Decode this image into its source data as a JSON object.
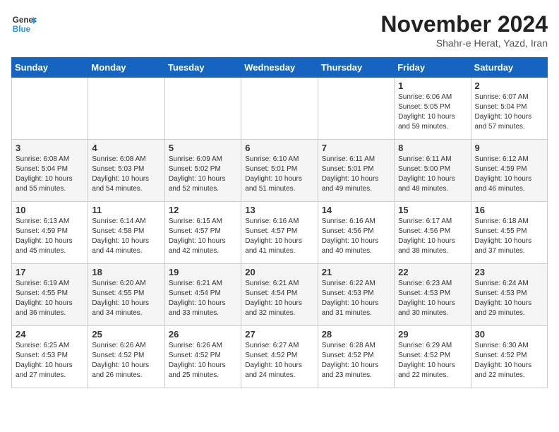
{
  "logo": {
    "general": "General",
    "blue": "Blue"
  },
  "title": "November 2024",
  "location": "Shahr-e Herat, Yazd, Iran",
  "weekdays": [
    "Sunday",
    "Monday",
    "Tuesday",
    "Wednesday",
    "Thursday",
    "Friday",
    "Saturday"
  ],
  "weeks": [
    [
      {
        "day": "",
        "info": ""
      },
      {
        "day": "",
        "info": ""
      },
      {
        "day": "",
        "info": ""
      },
      {
        "day": "",
        "info": ""
      },
      {
        "day": "",
        "info": ""
      },
      {
        "day": "1",
        "info": "Sunrise: 6:06 AM\nSunset: 5:05 PM\nDaylight: 10 hours and 59 minutes."
      },
      {
        "day": "2",
        "info": "Sunrise: 6:07 AM\nSunset: 5:04 PM\nDaylight: 10 hours and 57 minutes."
      }
    ],
    [
      {
        "day": "3",
        "info": "Sunrise: 6:08 AM\nSunset: 5:04 PM\nDaylight: 10 hours and 55 minutes."
      },
      {
        "day": "4",
        "info": "Sunrise: 6:08 AM\nSunset: 5:03 PM\nDaylight: 10 hours and 54 minutes."
      },
      {
        "day": "5",
        "info": "Sunrise: 6:09 AM\nSunset: 5:02 PM\nDaylight: 10 hours and 52 minutes."
      },
      {
        "day": "6",
        "info": "Sunrise: 6:10 AM\nSunset: 5:01 PM\nDaylight: 10 hours and 51 minutes."
      },
      {
        "day": "7",
        "info": "Sunrise: 6:11 AM\nSunset: 5:01 PM\nDaylight: 10 hours and 49 minutes."
      },
      {
        "day": "8",
        "info": "Sunrise: 6:11 AM\nSunset: 5:00 PM\nDaylight: 10 hours and 48 minutes."
      },
      {
        "day": "9",
        "info": "Sunrise: 6:12 AM\nSunset: 4:59 PM\nDaylight: 10 hours and 46 minutes."
      }
    ],
    [
      {
        "day": "10",
        "info": "Sunrise: 6:13 AM\nSunset: 4:59 PM\nDaylight: 10 hours and 45 minutes."
      },
      {
        "day": "11",
        "info": "Sunrise: 6:14 AM\nSunset: 4:58 PM\nDaylight: 10 hours and 44 minutes."
      },
      {
        "day": "12",
        "info": "Sunrise: 6:15 AM\nSunset: 4:57 PM\nDaylight: 10 hours and 42 minutes."
      },
      {
        "day": "13",
        "info": "Sunrise: 6:16 AM\nSunset: 4:57 PM\nDaylight: 10 hours and 41 minutes."
      },
      {
        "day": "14",
        "info": "Sunrise: 6:16 AM\nSunset: 4:56 PM\nDaylight: 10 hours and 40 minutes."
      },
      {
        "day": "15",
        "info": "Sunrise: 6:17 AM\nSunset: 4:56 PM\nDaylight: 10 hours and 38 minutes."
      },
      {
        "day": "16",
        "info": "Sunrise: 6:18 AM\nSunset: 4:55 PM\nDaylight: 10 hours and 37 minutes."
      }
    ],
    [
      {
        "day": "17",
        "info": "Sunrise: 6:19 AM\nSunset: 4:55 PM\nDaylight: 10 hours and 36 minutes."
      },
      {
        "day": "18",
        "info": "Sunrise: 6:20 AM\nSunset: 4:55 PM\nDaylight: 10 hours and 34 minutes."
      },
      {
        "day": "19",
        "info": "Sunrise: 6:21 AM\nSunset: 4:54 PM\nDaylight: 10 hours and 33 minutes."
      },
      {
        "day": "20",
        "info": "Sunrise: 6:21 AM\nSunset: 4:54 PM\nDaylight: 10 hours and 32 minutes."
      },
      {
        "day": "21",
        "info": "Sunrise: 6:22 AM\nSunset: 4:53 PM\nDaylight: 10 hours and 31 minutes."
      },
      {
        "day": "22",
        "info": "Sunrise: 6:23 AM\nSunset: 4:53 PM\nDaylight: 10 hours and 30 minutes."
      },
      {
        "day": "23",
        "info": "Sunrise: 6:24 AM\nSunset: 4:53 PM\nDaylight: 10 hours and 29 minutes."
      }
    ],
    [
      {
        "day": "24",
        "info": "Sunrise: 6:25 AM\nSunset: 4:53 PM\nDaylight: 10 hours and 27 minutes."
      },
      {
        "day": "25",
        "info": "Sunrise: 6:26 AM\nSunset: 4:52 PM\nDaylight: 10 hours and 26 minutes."
      },
      {
        "day": "26",
        "info": "Sunrise: 6:26 AM\nSunset: 4:52 PM\nDaylight: 10 hours and 25 minutes."
      },
      {
        "day": "27",
        "info": "Sunrise: 6:27 AM\nSunset: 4:52 PM\nDaylight: 10 hours and 24 minutes."
      },
      {
        "day": "28",
        "info": "Sunrise: 6:28 AM\nSunset: 4:52 PM\nDaylight: 10 hours and 23 minutes."
      },
      {
        "day": "29",
        "info": "Sunrise: 6:29 AM\nSunset: 4:52 PM\nDaylight: 10 hours and 22 minutes."
      },
      {
        "day": "30",
        "info": "Sunrise: 6:30 AM\nSunset: 4:52 PM\nDaylight: 10 hours and 22 minutes."
      }
    ]
  ]
}
